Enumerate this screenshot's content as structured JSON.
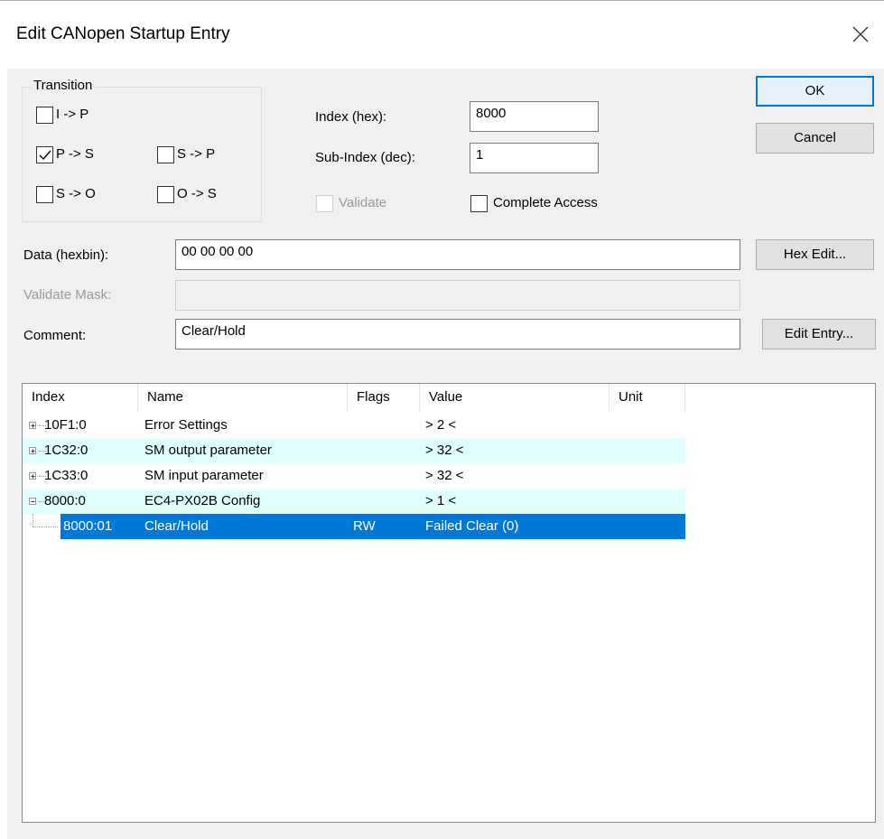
{
  "window": {
    "title": "Edit CANopen Startup Entry"
  },
  "transition": {
    "group_label": "Transition",
    "options": [
      {
        "label": "I -> P",
        "checked": false
      },
      {
        "label": "P -> S",
        "checked": true
      },
      {
        "label": "S -> P",
        "checked": false
      },
      {
        "label": "S -> O",
        "checked": false
      },
      {
        "label": "O -> S",
        "checked": false
      }
    ]
  },
  "fields": {
    "index_label": "Index (hex):",
    "index_value": "8000",
    "subindex_label": "Sub-Index (dec):",
    "subindex_value": "1",
    "validate_label": "Validate",
    "complete_access_label": "Complete Access",
    "data_label": "Data (hexbin):",
    "data_value": "00 00 00 00",
    "validate_mask_label": "Validate Mask:",
    "validate_mask_value": "",
    "comment_label": "Comment:",
    "comment_value": "Clear/Hold"
  },
  "buttons": {
    "ok": "OK",
    "cancel": "Cancel",
    "hex_edit": "Hex Edit...",
    "edit_entry": "Edit Entry..."
  },
  "table": {
    "columns": [
      "Index",
      "Name",
      "Flags",
      "Value",
      "Unit"
    ],
    "rows": [
      {
        "index": "10F1:0",
        "name": "Error Settings",
        "flags": "",
        "value": "> 2 <",
        "unit": "",
        "expander": "plus"
      },
      {
        "index": "1C32:0",
        "name": "SM output parameter",
        "flags": "",
        "value": "> 32 <",
        "unit": "",
        "expander": "plus"
      },
      {
        "index": "1C33:0",
        "name": "SM input parameter",
        "flags": "",
        "value": "> 32 <",
        "unit": "",
        "expander": "plus"
      },
      {
        "index": "8000:0",
        "name": "EC4-PX02B Config",
        "flags": "",
        "value": "> 1 <",
        "unit": "",
        "expander": "minus"
      },
      {
        "index": "8000:01",
        "name": "Clear/Hold",
        "flags": "RW",
        "value": "Failed Clear (0)",
        "unit": "",
        "expander": "none",
        "selected": true
      }
    ]
  },
  "colors": {
    "selection": "#0078d7",
    "alt_row": "#e0ffff",
    "dialog_bg": "#f0f0f0"
  }
}
